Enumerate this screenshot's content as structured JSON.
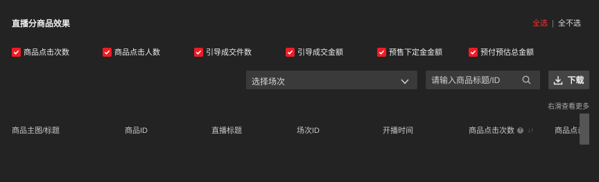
{
  "header": {
    "title": "直播分商品效果",
    "select_all": "全选",
    "deselect_all": "全不选"
  },
  "metrics": [
    {
      "label": "商品点击次数",
      "checked": true
    },
    {
      "label": "商品点击人数",
      "checked": true
    },
    {
      "label": "引导成交件数",
      "checked": true
    },
    {
      "label": "引导成交金额",
      "checked": true
    },
    {
      "label": "预售下定金金额",
      "checked": true
    },
    {
      "label": "预付预估总金额",
      "checked": true
    }
  ],
  "filters": {
    "session_select": "选择场次",
    "search_placeholder": "请输入商品标题/ID",
    "download_label": "下载"
  },
  "scroll_hint": "右滑查看更多",
  "table": {
    "columns": [
      "商品主图/标题",
      "商品ID",
      "直播标题",
      "场次ID",
      "开播时间",
      "商品点击次数",
      "商品点击"
    ]
  },
  "colors": {
    "accent": "#ee1c25",
    "background": "#232323"
  }
}
